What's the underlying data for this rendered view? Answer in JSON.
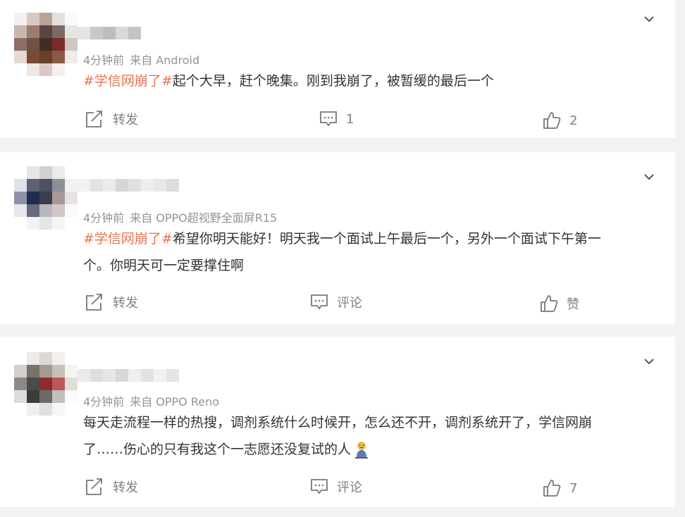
{
  "comments": [
    {
      "time": "4分钟前",
      "source": "来自 Android",
      "topic": "#学信网崩了#",
      "text": "起个大早，赶个晚集。刚到我崩了，被暂缓的最后一个",
      "repost_label": "转发",
      "comment_label": "1",
      "like_label": "2"
    },
    {
      "time": "4分钟前",
      "source": "来自 OPPO超视野全面屏R15",
      "topic": "#学信网崩了#",
      "text_line1": "希望你明天能好！明天我一个面试上午最后一个，另外一个面试下午第一",
      "text_line2": "个。你明天可一定要撑住啊",
      "repost_label": "转发",
      "comment_label": "评论",
      "like_label": "赞"
    },
    {
      "time": "4分钟前",
      "source": "来自 OPPO Reno",
      "text_line1": "每天走流程一样的热搜，调剂系统什么时候开，怎么还不开，调剂系统开了，学信网崩",
      "text_line2": "了……伤心的只有我这个一志愿还没复试的人",
      "repost_label": "转发",
      "comment_label": "评论",
      "like_label": "7"
    }
  ],
  "icons": {
    "caret": "chevron-down-icon",
    "repost": "share-icon",
    "comment": "comment-icon",
    "like": "thumbs-up-icon",
    "emoji": "sad-figure-emoji"
  },
  "colors": {
    "topic": "#eb7350",
    "meta": "#939393",
    "action": "#808080",
    "background": "#f2f2f2"
  }
}
